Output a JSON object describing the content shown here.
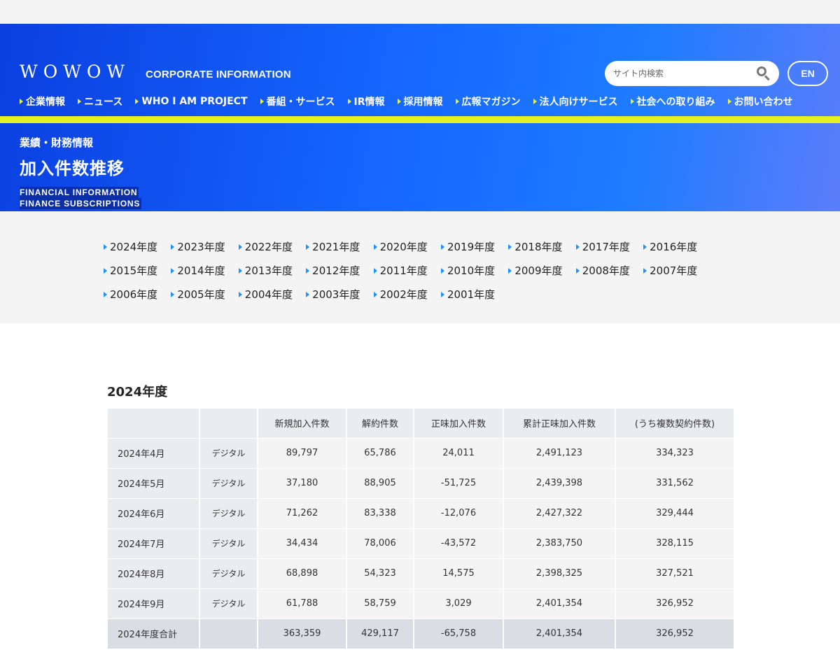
{
  "header": {
    "logo": "WOWOW",
    "corporate": "CORPORATE INFORMATION",
    "search_placeholder": "サイト内検索",
    "en_label": "EN",
    "nav": [
      "企業情報",
      "ニュース",
      "WHO I AM PROJECT",
      "番組・サービス",
      "IR情報",
      "採用情報",
      "広報マガジン",
      "法人向けサービス",
      "社会への取り組み",
      "お問い合わせ"
    ],
    "breadcrumb": "業績・財務情報",
    "title": "加入件数推移",
    "en_line1": "FINANCIAL INFORMATION",
    "en_line2": "FINANCE SUBSCRIPTIONS"
  },
  "years": [
    "2024年度",
    "2023年度",
    "2022年度",
    "2021年度",
    "2020年度",
    "2019年度",
    "2018年度",
    "2017年度",
    "2016年度",
    "2015年度",
    "2014年度",
    "2013年度",
    "2012年度",
    "2011年度",
    "2010年度",
    "2009年度",
    "2008年度",
    "2007年度",
    "2006年度",
    "2005年度",
    "2004年度",
    "2003年度",
    "2002年度",
    "2001年度"
  ],
  "section": {
    "title": "2024年度",
    "columns": [
      "新規加入件数",
      "解約件数",
      "正味加入件数",
      "累計正味加入件数",
      "(うち複数契約件数)"
    ],
    "rows": [
      {
        "month": "2024年4月",
        "type": "デジタル",
        "new": "89,797",
        "cancel": "65,786",
        "net": "24,011",
        "cum": "2,491,123",
        "multi": "334,323"
      },
      {
        "month": "2024年5月",
        "type": "デジタル",
        "new": "37,180",
        "cancel": "88,905",
        "net": "-51,725",
        "cum": "2,439,398",
        "multi": "331,562"
      },
      {
        "month": "2024年6月",
        "type": "デジタル",
        "new": "71,262",
        "cancel": "83,338",
        "net": "-12,076",
        "cum": "2,427,322",
        "multi": "329,444"
      },
      {
        "month": "2024年7月",
        "type": "デジタル",
        "new": "34,434",
        "cancel": "78,006",
        "net": "-43,572",
        "cum": "2,383,750",
        "multi": "328,115"
      },
      {
        "month": "2024年8月",
        "type": "デジタル",
        "new": "68,898",
        "cancel": "54,323",
        "net": "14,575",
        "cum": "2,398,325",
        "multi": "327,521"
      },
      {
        "month": "2024年9月",
        "type": "デジタル",
        "new": "61,788",
        "cancel": "58,759",
        "net": "3,029",
        "cum": "2,401,354",
        "multi": "326,952"
      }
    ],
    "total": {
      "month": "2024年度合計",
      "type": "",
      "new": "363,359",
      "cancel": "429,117",
      "net": "-65,758",
      "cum": "2,401,354",
      "multi": "326,952"
    }
  }
}
